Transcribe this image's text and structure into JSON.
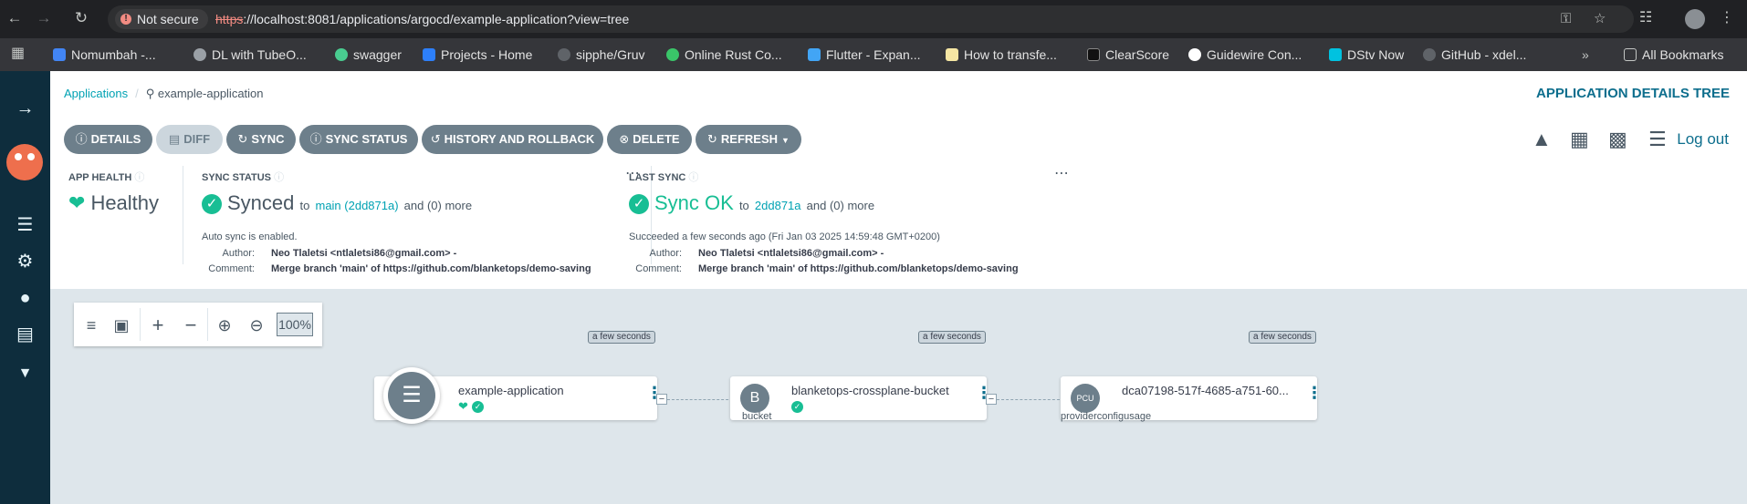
{
  "browser": {
    "not_secure": "Not secure",
    "url_scheme": "https",
    "url_rest": "://localhost:8081/applications/argocd/example-application?view=tree",
    "bookmarks": [
      {
        "label": "Nomumbah -...",
        "color": "#4285f4"
      },
      {
        "label": "DL with TubeO...",
        "color": "#9aa0a6"
      },
      {
        "label": "swagger",
        "color": "#49cc90"
      },
      {
        "label": "Projects - Home",
        "color": "#2d7ff9"
      },
      {
        "label": "sipphe/Gruv",
        "color": "#5f6368"
      },
      {
        "label": "Online Rust Co...",
        "color": "#3ac569"
      },
      {
        "label": "Flutter - Expan...",
        "color": "#42a5f5"
      },
      {
        "label": "How to transfe...",
        "color": "#f5e6a3"
      },
      {
        "label": "ClearScore",
        "color": "#111111"
      },
      {
        "label": "Guidewire Con...",
        "color": "#ffffff"
      },
      {
        "label": "DStv Now",
        "color": "#00c2e0"
      },
      {
        "label": "GitHub - xdel...",
        "color": "#5f6368"
      }
    ],
    "all_bookmarks": "All Bookmarks"
  },
  "breadcrumb": {
    "root": "Applications",
    "current": "example-application"
  },
  "page_title": "APPLICATION DETAILS TREE",
  "toolbar": {
    "details": "DETAILS",
    "diff": "DIFF",
    "sync": "SYNC",
    "sync_status": "SYNC STATUS",
    "history": "HISTORY AND ROLLBACK",
    "delete": "DELETE",
    "refresh": "REFRESH"
  },
  "logout": "Log out",
  "app_health": {
    "label": "APP HEALTH",
    "value": "Healthy"
  },
  "sync_status": {
    "label": "SYNC STATUS",
    "value": "Synced",
    "to": "to",
    "ref": "main (2dd871a)",
    "more": "and (0) more",
    "auto_sync": "Auto sync is enabled.",
    "author_key": "Author:",
    "author": "Neo Tlaletsi <ntlaletsi86@gmail.com> -",
    "comment_key": "Comment:",
    "comment": "Merge branch 'main' of https://github.com/blanketops/demo-saving"
  },
  "last_sync": {
    "label": "LAST SYNC",
    "value": "Sync OK",
    "to": "to",
    "ref": "2dd871a",
    "more": "and (0) more",
    "succeeded": "Succeeded a few seconds ago (Fri Jan 03 2025 14:59:48 GMT+0200)",
    "author_key": "Author:",
    "author": "Neo Tlaletsi <ntlaletsi86@gmail.com> -",
    "comment_key": "Comment:",
    "comment": "Merge branch 'main' of https://github.com/blanketops/demo-saving"
  },
  "zoom": {
    "level": "100%"
  },
  "nodes": [
    {
      "name": "example-application",
      "kind": "",
      "time": "a few seconds",
      "icon": "layers-icon"
    },
    {
      "name": "blanketops-crossplane-bucket",
      "kind": "bucket",
      "time": "a few seconds",
      "icon_text": "B"
    },
    {
      "name": "dca07198-517f-4685-a751-60...",
      "kind": "providerconfigusage",
      "time": "a few seconds",
      "icon_text": "PCU"
    }
  ],
  "colors": {
    "healthy": "#18be94",
    "accent": "#0d6e8d",
    "link": "#00a2b3",
    "sidebar": "#0e2d3d"
  }
}
